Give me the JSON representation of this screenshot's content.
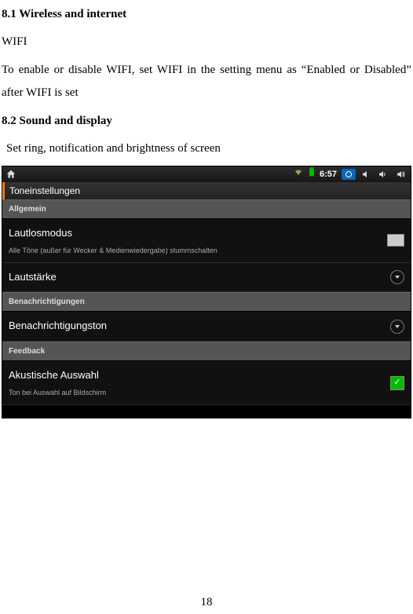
{
  "doc": {
    "h81": "8.1 Wireless and internet",
    "wifi_label": "WIFI",
    "wifi_para": "To enable or disable WIFI, set WIFI in the setting menu as “Enabled or Disabled” after WIFI is set",
    "h82": "8.2 Sound and display",
    "sound_para": "Set ring, notification and brightness of screen",
    "page_number": "18"
  },
  "shot": {
    "status": {
      "time": "6:57"
    },
    "title": "Toneinstellungen",
    "cat_allgemein": "Allgemein",
    "lautlos": {
      "title": "Lautlosmodus",
      "sub": "Alle Töne (außer für Wecker & Medienwiedergabe) stummschalten"
    },
    "lautstarke": {
      "title": "Lautstärke"
    },
    "cat_benach": "Benachrichtigungen",
    "benachton": {
      "title": "Benachrichtigungston"
    },
    "cat_feedback": "Feedback",
    "akustische": {
      "title": "Akustische Auswahl",
      "sub": "Ton bei Auswahl auf Bildschirm"
    }
  }
}
